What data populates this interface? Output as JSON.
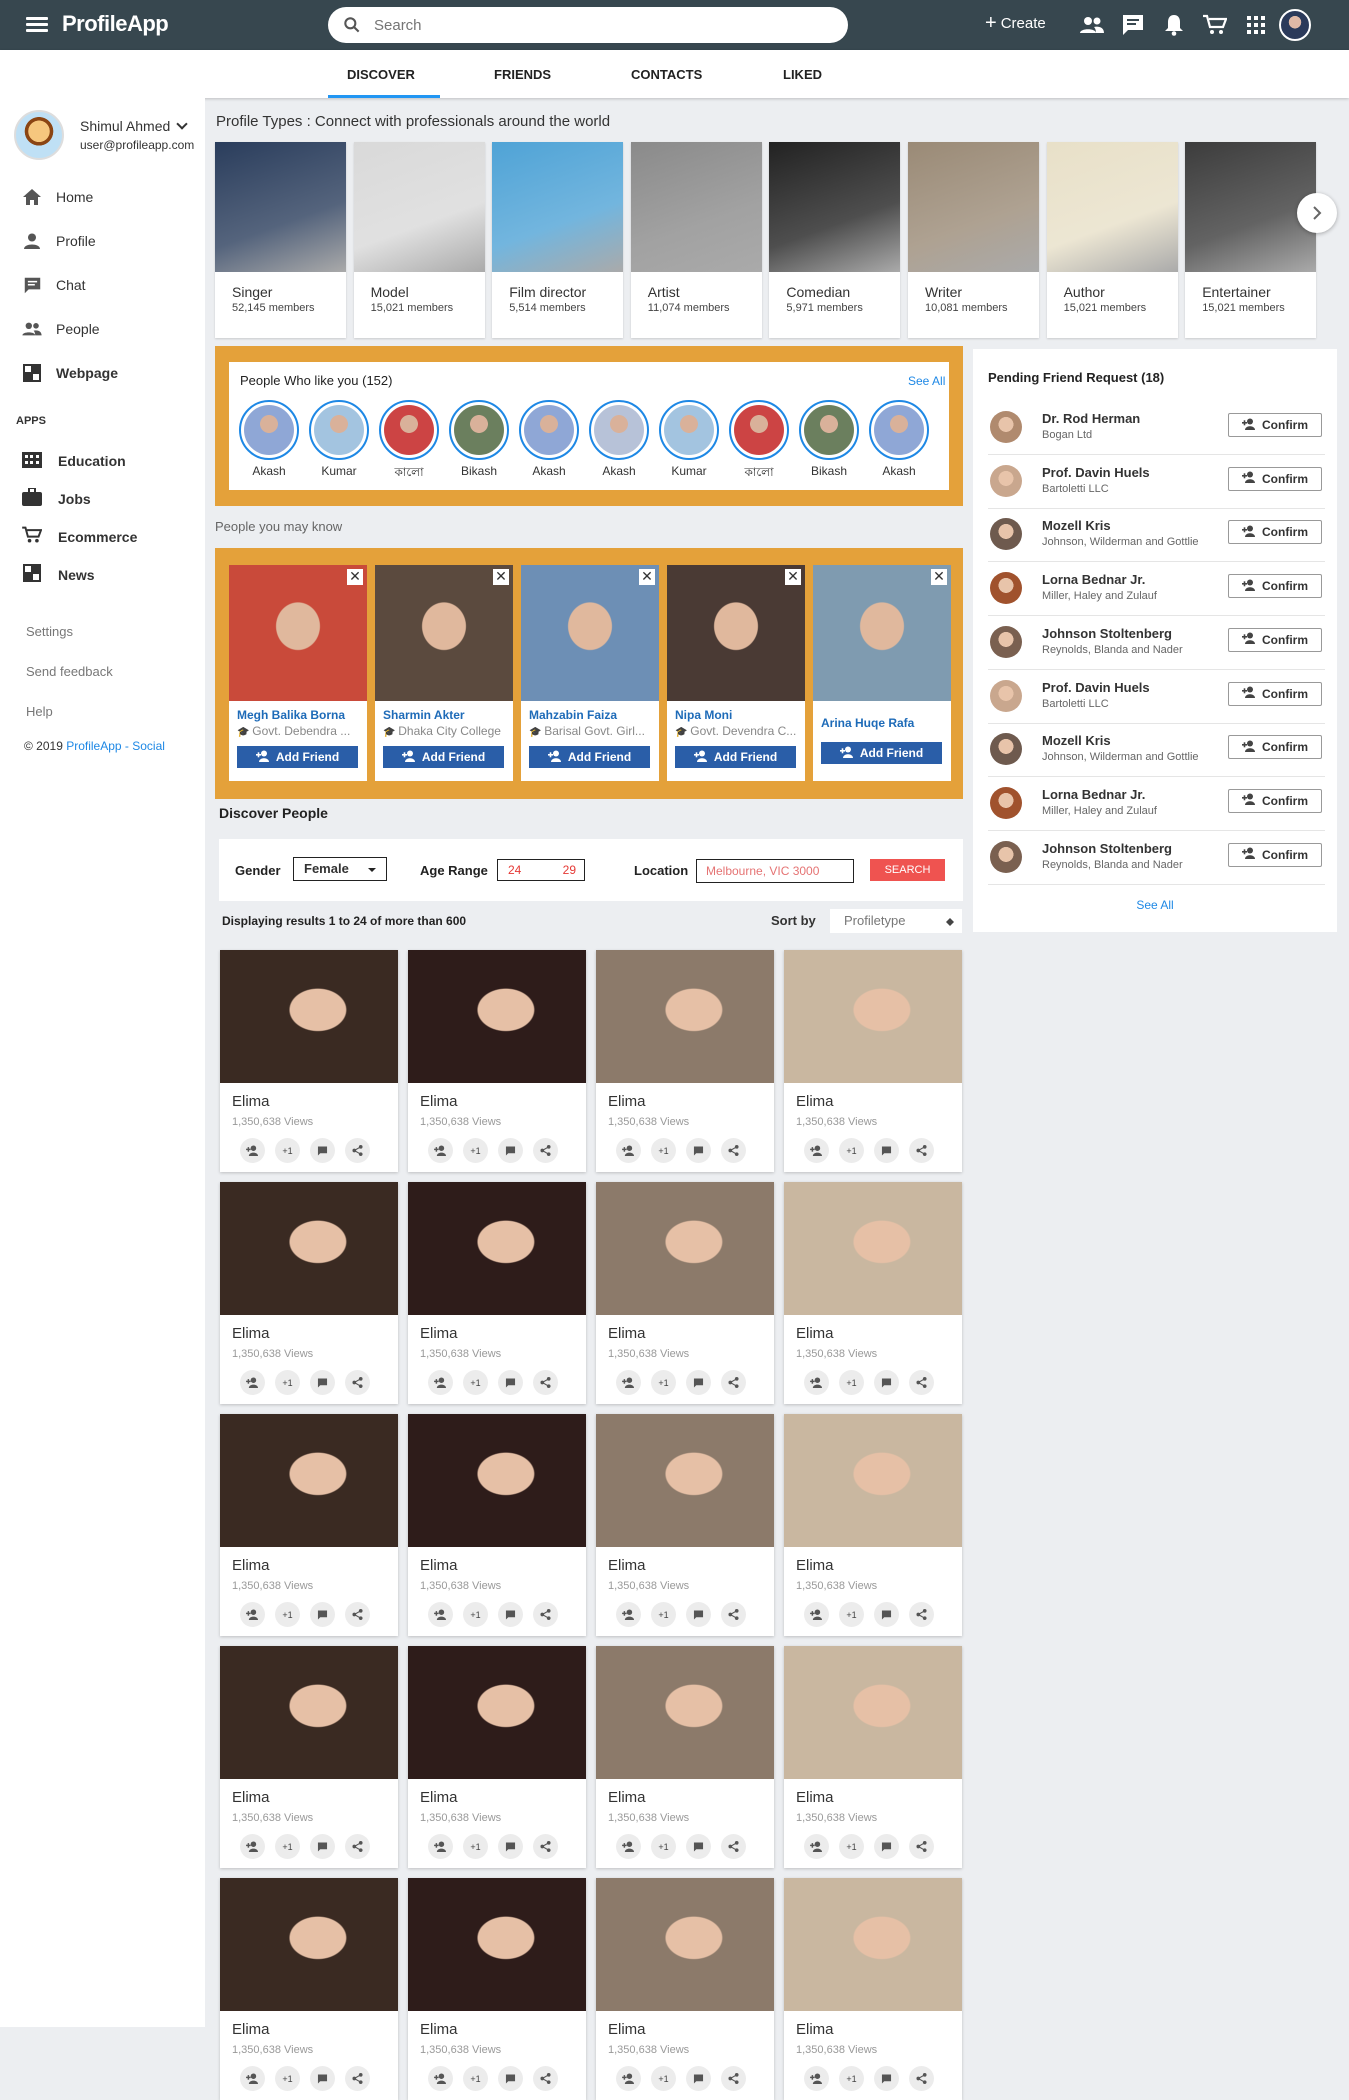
{
  "header": {
    "logo": "ProfileApp",
    "search_placeholder": "Search",
    "create_label": "Create",
    "icons": [
      "people-icon",
      "chat-icon",
      "bell-icon",
      "cart-icon",
      "apps-grid-icon"
    ]
  },
  "tabs": [
    {
      "label": "DISCOVER",
      "active": true
    },
    {
      "label": "FRIENDS"
    },
    {
      "label": "CONTACTS"
    },
    {
      "label": "LIKED"
    }
  ],
  "sidebar": {
    "user_name": "Shimul Ahmed",
    "user_email": "user@profileapp.com",
    "nav": [
      {
        "label": "Home",
        "icon": "home-icon"
      },
      {
        "label": "Profile",
        "icon": "person-icon"
      },
      {
        "label": "Chat",
        "icon": "chat-icon"
      },
      {
        "label": "People",
        "icon": "people-icon"
      },
      {
        "label": "Webpage",
        "icon": "webpage-icon"
      }
    ],
    "apps_heading": "APPS",
    "apps": [
      {
        "label": "Education",
        "icon": "education-icon"
      },
      {
        "label": "Jobs",
        "icon": "briefcase-icon"
      },
      {
        "label": "Ecommerce",
        "icon": "cart-icon"
      },
      {
        "label": "News",
        "icon": "news-icon"
      }
    ],
    "links": [
      "Settings",
      "Send feedback",
      "Help"
    ],
    "copyright_prefix": "© 2019",
    "copyright_link": "ProfileApp - Social"
  },
  "profile_types": {
    "title": "Profile Types : Connect with professionals around the world",
    "items": [
      {
        "name": "Singer",
        "members": "52,145 members",
        "color": "#2a3d5c"
      },
      {
        "name": "Model",
        "members": "15,021 members",
        "color": "#d9d9d9"
      },
      {
        "name": "Film director",
        "members": "5,514 members",
        "color": "#4fa3d6"
      },
      {
        "name": "Artist",
        "members": "11,074 members",
        "color": "#8a8a8a"
      },
      {
        "name": "Comedian",
        "members": "5,971 members",
        "color": "#222222"
      },
      {
        "name": "Writer",
        "members": "10,081 members",
        "color": "#9a8a76"
      },
      {
        "name": "Author",
        "members": "15,021 members",
        "color": "#e8e0c8"
      },
      {
        "name": "Entertainer",
        "members": "15,021 members",
        "color": "#3c3c3c"
      }
    ]
  },
  "likes": {
    "title": "People Who like you (152)",
    "see_all": "See All",
    "people": [
      "Akash",
      "Kumar",
      "কালো",
      "Bikash",
      "Akash",
      "Akash",
      "Kumar",
      "কালো",
      "Bikash",
      "Akash"
    ]
  },
  "pymk": {
    "title": "People you may know",
    "add_label": "Add Friend",
    "people": [
      {
        "name": "Megh Balika Borna",
        "school": "Govt. Debendra ...",
        "color": "#c94a3a"
      },
      {
        "name": "Sharmin Akter",
        "school": "Dhaka City College",
        "color": "#5b4a3e"
      },
      {
        "name": "Mahzabin Faiza",
        "school": "Barisal Govt. Girl...",
        "color": "#6d8fb5"
      },
      {
        "name": "Nipa Moni",
        "school": "Govt. Devendra C...",
        "color": "#4a3a34"
      },
      {
        "name": "Arina Huqe Rafa",
        "school": "",
        "color": "#7f9bb0"
      }
    ]
  },
  "discover": {
    "title": "Discover People",
    "gender_label": "Gender",
    "gender_value": "Female",
    "age_label": "Age Range",
    "age_min": "24",
    "age_max": "29",
    "location_label": "Location",
    "location_value": "Melbourne, VIC 3000",
    "search_btn": "SEARCH",
    "results_text": "Displaying results 1 to 24 of more than 600",
    "sort_label": "Sort by",
    "sort_value": "Profiletype",
    "card_name": "Elima",
    "card_views": "1,350,638 Views",
    "plus_one": "+1",
    "card_colors": [
      "#3a2a22",
      "#2e1c1a",
      "#8c7a6a",
      "#c9b7a0"
    ]
  },
  "pending": {
    "title": "Pending Friend Request (18)",
    "confirm_label": "Confirm",
    "see_all": "See All",
    "requests": [
      {
        "name": "Dr. Rod Herman",
        "company": "Bogan Ltd"
      },
      {
        "name": "Prof. Davin Huels",
        "company": "Bartoletti LLC"
      },
      {
        "name": "Mozell Kris",
        "company": "Johnson, Wilderman and Gottlie"
      },
      {
        "name": "Lorna Bednar Jr.",
        "company": "Miller, Haley and Zulauf"
      },
      {
        "name": "Johnson Stoltenberg",
        "company": "Reynolds, Blanda and Nader"
      },
      {
        "name": "Prof. Davin Huels",
        "company": "Bartoletti LLC"
      },
      {
        "name": "Mozell Kris",
        "company": "Johnson, Wilderman and Gottlie"
      },
      {
        "name": "Lorna Bednar Jr.",
        "company": "Miller, Haley and Zulauf"
      },
      {
        "name": "Johnson Stoltenberg",
        "company": "Reynolds, Blanda and Nader"
      }
    ]
  },
  "colors": {
    "topbar": "#37474f",
    "accent": "#2196f3",
    "orange_panel": "#e4a13a",
    "add_friend_button": "#2a5ea8",
    "search_button": "#ef5350"
  }
}
